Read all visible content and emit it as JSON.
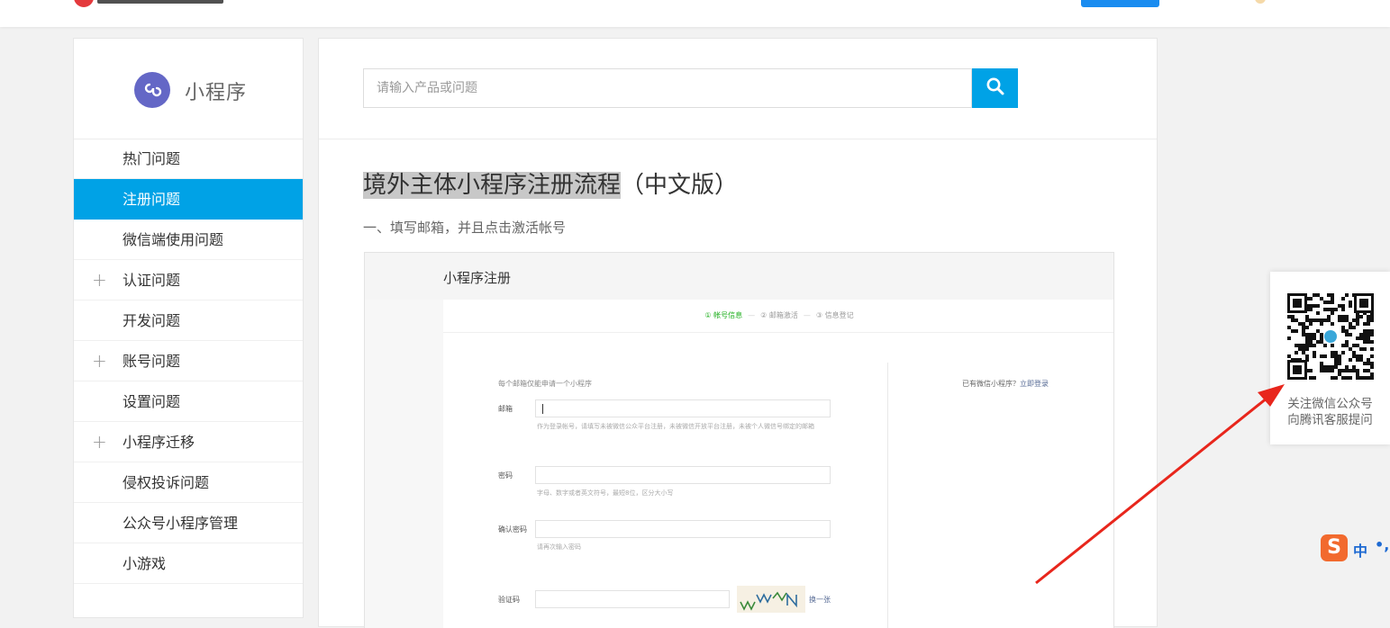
{
  "sidebar": {
    "brand_name": "小程序",
    "items": [
      {
        "label": "热门问题",
        "expandable": false,
        "active": false
      },
      {
        "label": "注册问题",
        "expandable": false,
        "active": true
      },
      {
        "label": "微信端使用问题",
        "expandable": false,
        "active": false
      },
      {
        "label": "认证问题",
        "expandable": true,
        "active": false
      },
      {
        "label": "开发问题",
        "expandable": false,
        "active": false
      },
      {
        "label": "账号问题",
        "expandable": true,
        "active": false
      },
      {
        "label": "设置问题",
        "expandable": false,
        "active": false
      },
      {
        "label": "小程序迁移",
        "expandable": true,
        "active": false
      },
      {
        "label": "侵权投诉问题",
        "expandable": false,
        "active": false
      },
      {
        "label": "公众号小程序管理",
        "expandable": false,
        "active": false
      },
      {
        "label": "小游戏",
        "expandable": false,
        "active": false
      }
    ],
    "expand_symbol": "+"
  },
  "search": {
    "placeholder": "请输入产品或问题",
    "value": ""
  },
  "article": {
    "title_highlight": "境外主体小程序注册流程",
    "title_rest": "（中文版）",
    "step1": "一、填写邮箱，并且点击激活帐号"
  },
  "screenshot": {
    "title": "小程序注册",
    "steps": [
      "① 帐号信息",
      "② 邮箱激活",
      "③ 信息登记"
    ],
    "step_separator": "—",
    "tip_left": "每个邮箱仅能申请一个小程序",
    "tip_right_prefix": "已有微信小程序？",
    "tip_right_link": "立即登录",
    "fields": {
      "email_label": "邮箱",
      "email_hint": "作为登录帐号，请填写未被微信公众平台注册，未被微信开放平台注册，未被个人微信号绑定的邮箱",
      "password_label": "密码",
      "password_hint": "字母、数字或者英文符号，最短8位，区分大小写",
      "confirm_label": "确认密码",
      "confirm_hint": "请再次输入密码",
      "captcha_label": "验证码",
      "captcha_swap": "换一张"
    }
  },
  "qr": {
    "line1": "关注微信公众号",
    "line2": "向腾讯客服提问"
  },
  "ime": {
    "logo": "S",
    "mode": "中",
    "punct": "•,"
  },
  "colors": {
    "accent": "#00a2e6",
    "brand_icon": "#6467c6",
    "arrow": "#e8261c",
    "step_active": "#1aad19"
  }
}
